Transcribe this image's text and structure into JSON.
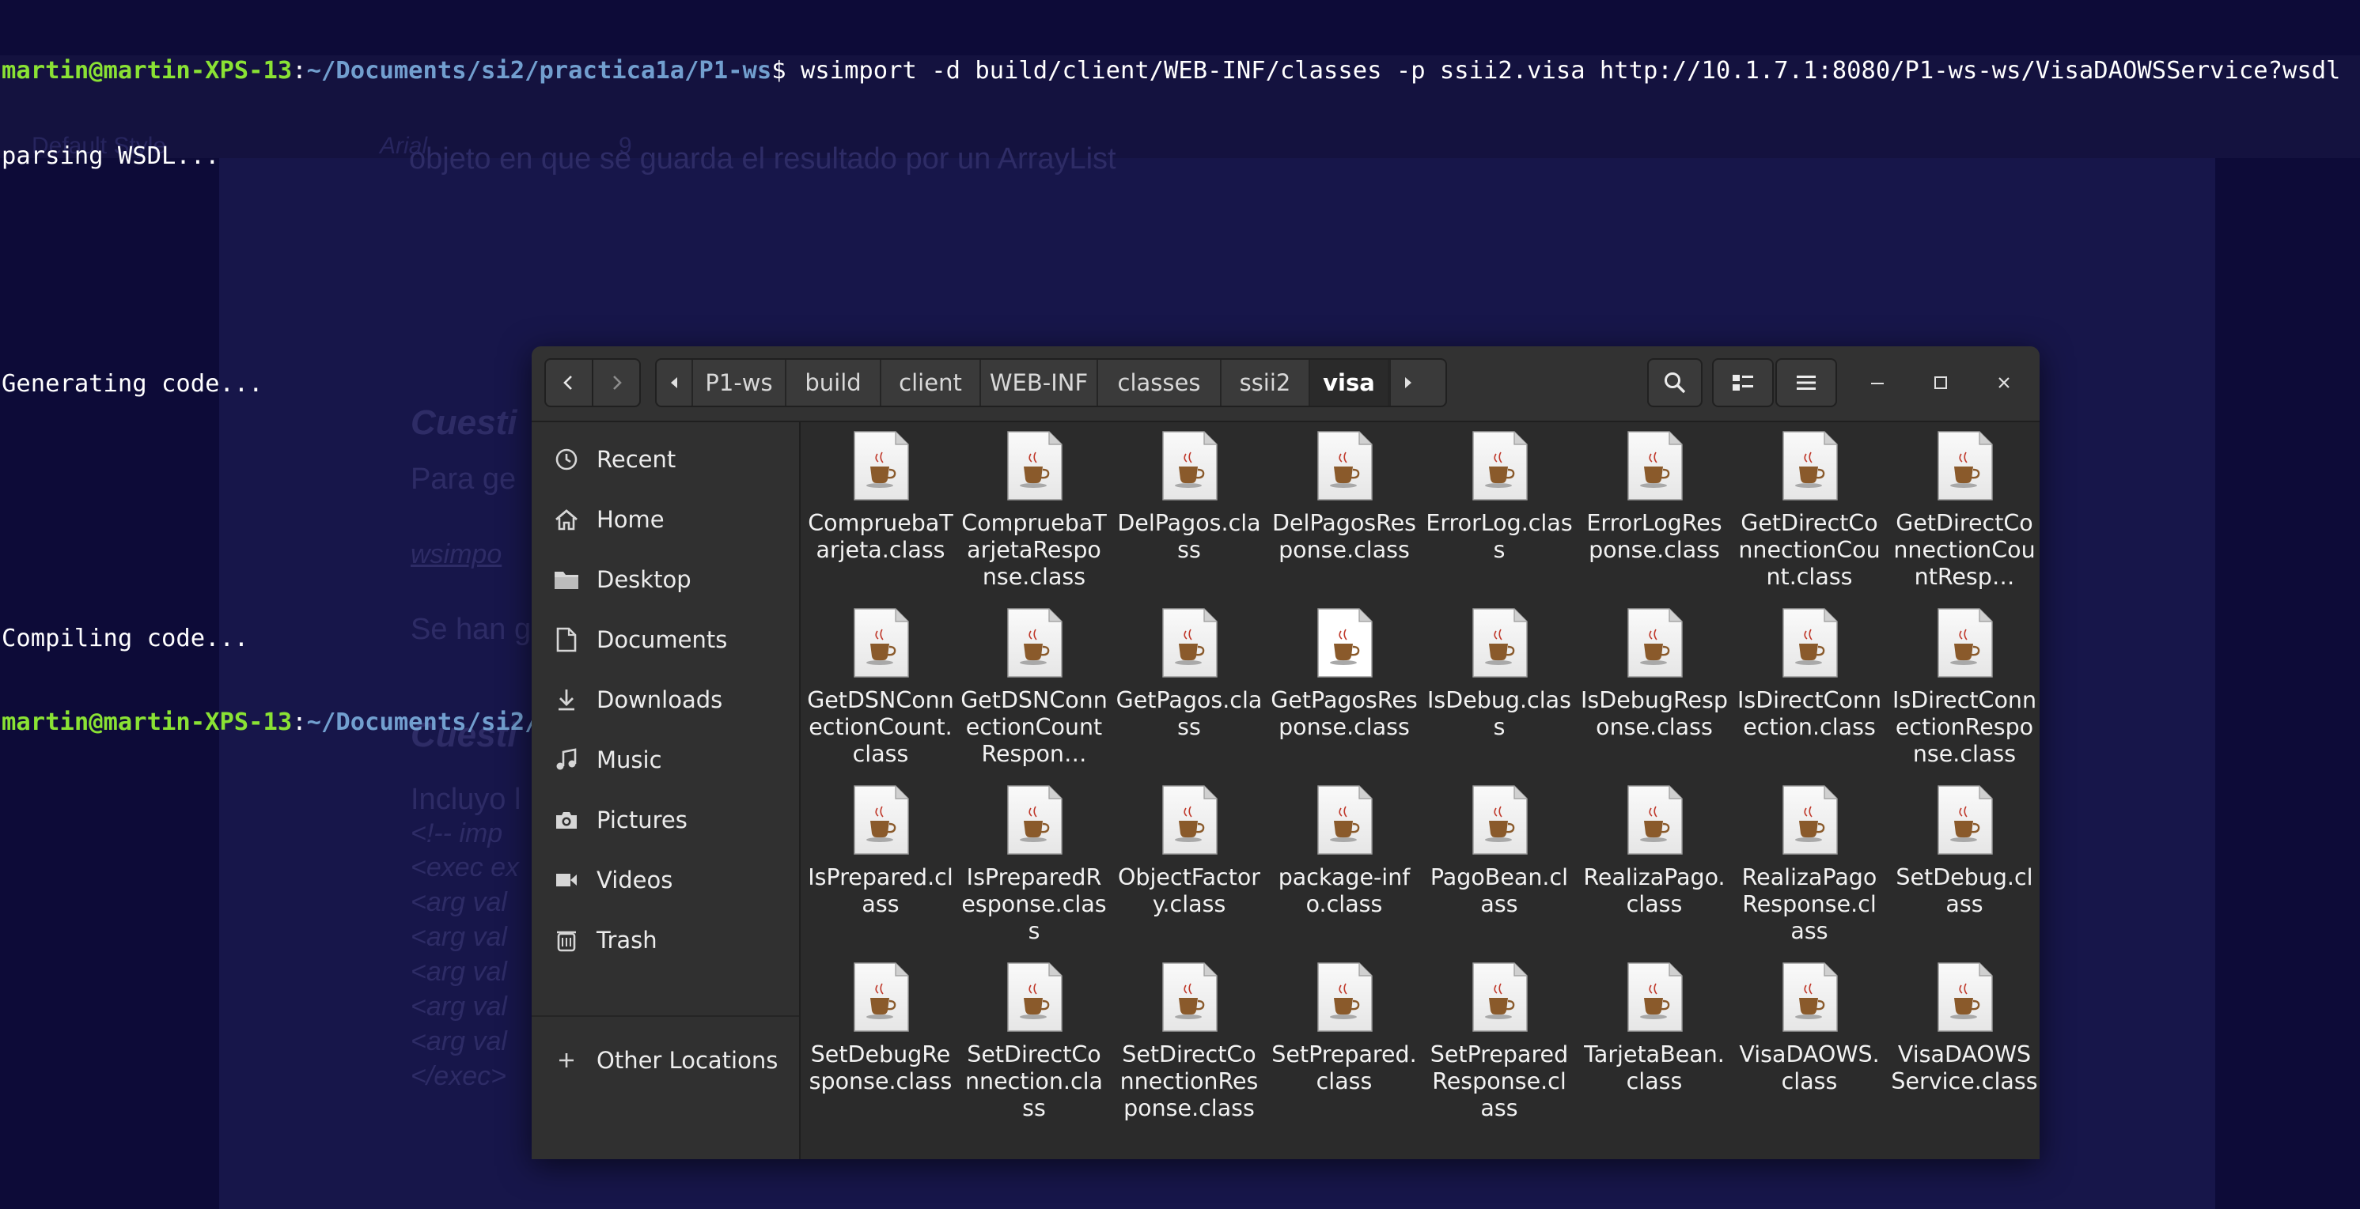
{
  "terminal": {
    "user_host": "martin@martin-XPS-13",
    "colon": ":",
    "path": "~/Documents/si2/practica1a/P1-ws",
    "prompt_end": "$ ",
    "command": "wsimport -d build/client/WEB-INF/classes -p ssii2.visa http://10.1.7.1:8080/P1-ws-ws/VisaDAOWSService?wsdl",
    "output": [
      "parsing WSDL...",
      "",
      "",
      "Generating code...",
      "",
      "",
      "Compiling code...",
      ""
    ]
  },
  "background_doc": {
    "toolbar_style": "Default Style",
    "toolbar_font": "Arial",
    "toolbar_size": "9",
    "partial_line": "objeto en que se guarda el resultado por un ArrayList",
    "heading1": "Cuesti",
    "para1": "Para ge",
    "link1": "wsimpo",
    "para2": "Se han g",
    "heading2": "Cuesti",
    "para3": "Incluyo l",
    "code_lines": [
      "<!-- imp",
      "<exec ex",
      "<arg val",
      "<arg val",
      "<arg val",
      "<arg val",
      "<arg val",
      "</exec>"
    ]
  },
  "file_manager": {
    "breadcrumbs": [
      "P1-ws",
      "build",
      "client",
      "WEB-INF",
      "classes",
      "ssii2",
      "visa"
    ],
    "active_crumb": "visa",
    "sidebar": [
      {
        "label": "Recent",
        "icon": "clock-icon"
      },
      {
        "label": "Home",
        "icon": "home-icon"
      },
      {
        "label": "Desktop",
        "icon": "folder-icon"
      },
      {
        "label": "Documents",
        "icon": "document-icon"
      },
      {
        "label": "Downloads",
        "icon": "download-icon"
      },
      {
        "label": "Music",
        "icon": "music-icon"
      },
      {
        "label": "Pictures",
        "icon": "camera-icon"
      },
      {
        "label": "Videos",
        "icon": "video-icon"
      },
      {
        "label": "Trash",
        "icon": "trash-icon"
      }
    ],
    "other_locations": "Other Locations",
    "files": [
      "Comprueba​Tarjeta.​class",
      "Comprueba​TarjetaRes​ponse.class",
      "DelPagos.​class",
      "DelPagosR​esponse.​class",
      "ErrorLog.​class",
      "ErrorLogRe​sponse.​class",
      "GetDirectC​onnectionC​ount.class",
      "GetDirectC​onnectionC​ountResp…",
      "GetDSNCon​nectionCou​nt.class",
      "GetDSNCon​nectionCou​ntRespon…",
      "GetPagos.​class",
      "GetPagosR​esponse.​class",
      "IsDebug.​class",
      "IsDebugRes​ponse.class",
      "IsDirectCon​nection.​class",
      "IsDirectCon​nectionRes​ponse.class",
      "IsPrepared.​class",
      "IsPrepared​Response.​class",
      "ObjectFact​ory.class",
      "package-​info.class",
      "PagoBean.​class",
      "RealizaPag​o.class",
      "RealizaPag​oResponse.​class",
      "SetDebug.​class",
      "SetDebugR​esponse.​class",
      "SetDirectC​onnection.​class",
      "SetDirectC​onnectionR​esponse.​class",
      "SetPrepare​d.class",
      "SetPrepare​dResponse.​class",
      "TarjetaBea​n.class",
      "VisaDAOW​S.class",
      "VisaDAOW​SService.​class"
    ],
    "colors": {
      "bg": "#2b2b2b",
      "sidebar": "#303030",
      "header": "#323232",
      "text": "#f2f2f2"
    }
  }
}
